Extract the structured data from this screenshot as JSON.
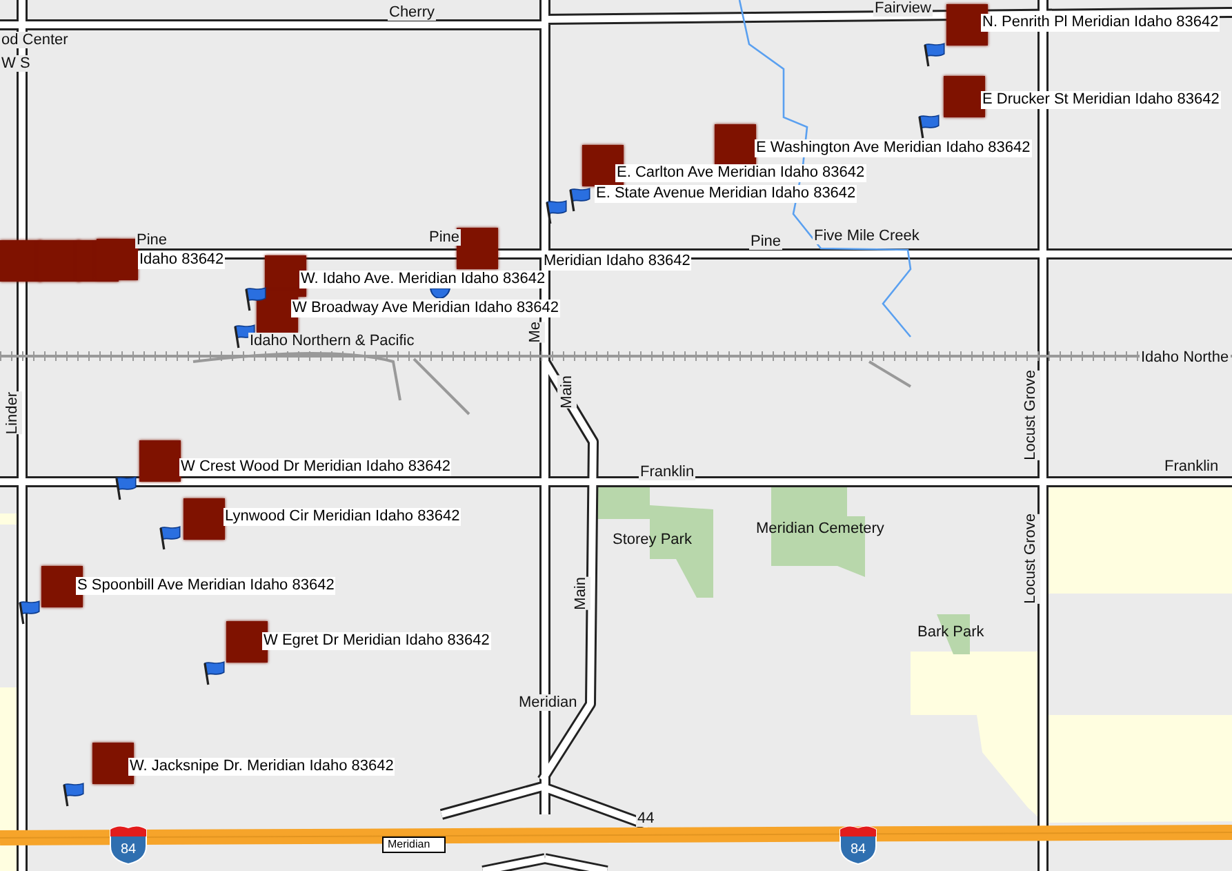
{
  "map": {
    "road_labels": [
      {
        "text": "Cherry",
        "kind": "horizontal"
      },
      {
        "text": "od Center",
        "kind": "horizontal"
      },
      {
        "text": "W S",
        "kind": "horizontal"
      },
      {
        "text": "Fairview",
        "kind": "horizontal"
      },
      {
        "text": "Pine",
        "kind": "horizontal"
      },
      {
        "text": "Pine",
        "kind": "horizontal"
      },
      {
        "text": "Pine",
        "kind": "horizontal"
      },
      {
        "text": "Five Mile Creek",
        "kind": "horizontal"
      },
      {
        "text": "Idaho Northern & Pacific",
        "kind": "horizontal"
      },
      {
        "text": "Idaho Northe",
        "kind": "horizontal"
      },
      {
        "text": "Linder",
        "kind": "vertical"
      },
      {
        "text": "Me",
        "kind": "vertical"
      },
      {
        "text": "Main",
        "kind": "vertical"
      },
      {
        "text": "Main",
        "kind": "vertical"
      },
      {
        "text": "Franklin",
        "kind": "horizontal"
      },
      {
        "text": "Franklin",
        "kind": "horizontal"
      },
      {
        "text": "Locust Grove",
        "kind": "vertical"
      },
      {
        "text": "Locust Grove",
        "kind": "vertical"
      },
      {
        "text": "Meridian",
        "kind": "horizontal"
      },
      {
        "text": "44",
        "kind": "horizontal"
      }
    ],
    "place_labels": [
      "Storey Park",
      "Meridian Cemetery",
      "Bark Park"
    ],
    "address_labels": [
      "N. Penrith Pl Meridian Idaho 83642",
      "E Drucker St Meridian Idaho 83642",
      "E Washington Ave Meridian Idaho 83642",
      "E. Carlton Ave Meridian Idaho 83642",
      "E. State Avenue Meridian Idaho 83642",
      "Idaho 83642",
      "W. Idaho Ave. Meridian Idaho 83642",
      "Meridian Idaho 83642",
      "W Broadway Ave Meridian Idaho 83642",
      "W Crest Wood Dr Meridian Idaho 83642",
      "Lynwood Cir Meridian Idaho 83642",
      "S Spoonbill Ave Meridian Idaho 83642",
      "W Egret Dr Meridian Idaho 83642",
      "W. Jacksnipe Dr. Meridian Idaho 83642"
    ],
    "interstate_shields": [
      "84",
      "84"
    ],
    "exit_sign": "Meridian"
  }
}
